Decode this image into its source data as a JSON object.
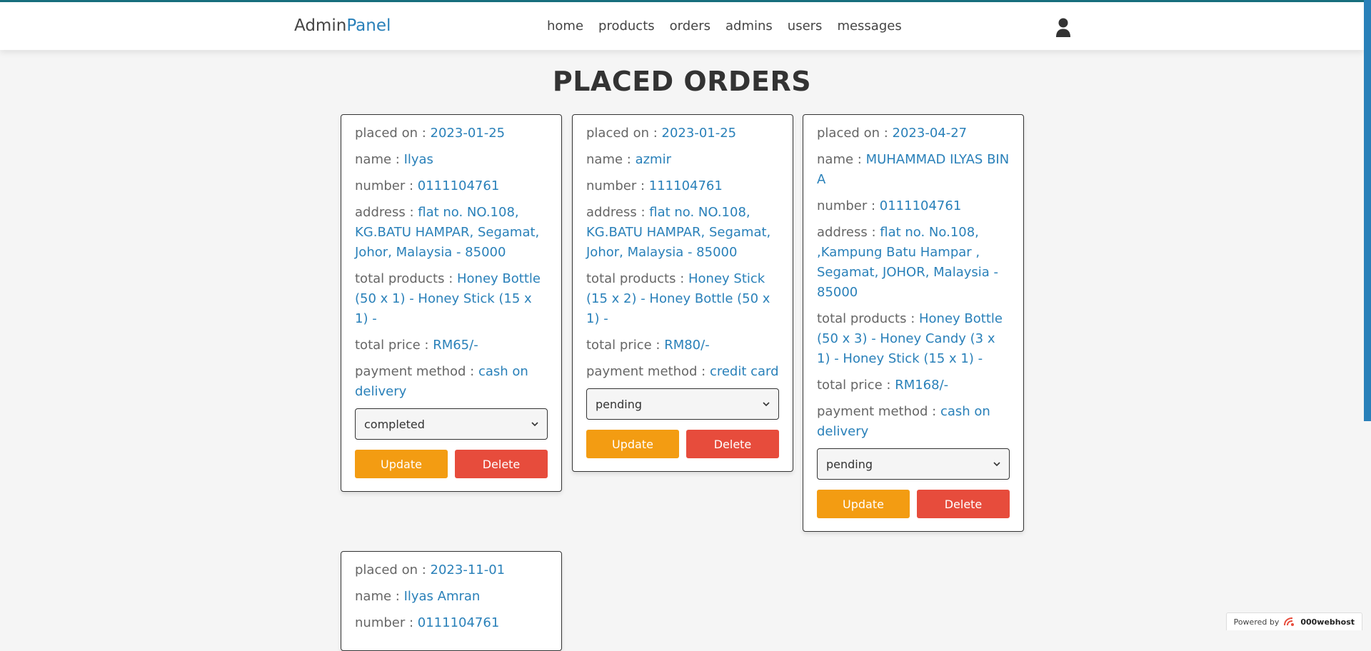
{
  "header": {
    "logo_main": "Admin",
    "logo_accent": "Panel",
    "nav": [
      "home",
      "products",
      "orders",
      "admins",
      "users",
      "messages"
    ]
  },
  "page_title": "PLACED ORDERS",
  "labels": {
    "placed_on": "placed on : ",
    "name": "name : ",
    "number": "number : ",
    "address": "address : ",
    "total_products": "total products : ",
    "total_price": "total price : ",
    "payment_method": "payment method : ",
    "update": "Update",
    "delete": "Delete"
  },
  "orders": [
    {
      "placed_on": "2023-01-25",
      "name": "Ilyas",
      "number": "0111104761",
      "address": "flat no. NO.108, KG.BATU HAMPAR, Segamat, Johor, Malaysia - 85000",
      "total_products": "Honey Bottle (50 x 1) - Honey Stick (15 x 1) -",
      "total_price": "RM65/-",
      "payment_method": "cash on delivery",
      "status": "completed"
    },
    {
      "placed_on": "2023-01-25",
      "name": "azmir",
      "number": "111104761",
      "address": "flat no. NO.108, KG.BATU HAMPAR, Segamat, Johor, Malaysia - 85000",
      "total_products": "Honey Stick (15 x 2) - Honey Bottle (50 x 1) -",
      "total_price": "RM80/-",
      "payment_method": "credit card",
      "status": "pending"
    },
    {
      "placed_on": "2023-04-27",
      "name": "MUHAMMAD ILYAS BIN A",
      "number": "0111104761",
      "address": "flat no. No.108, ,Kampung Batu Hampar , Segamat, JOHOR, Malaysia - 85000",
      "total_products": "Honey Bottle (50 x 3) - Honey Candy (3 x 1) - Honey Stick (15 x 1) -",
      "total_price": "RM168/-",
      "payment_method": "cash on delivery",
      "status": "pending"
    },
    {
      "placed_on": "2023-11-01",
      "name": "Ilyas Amran",
      "number": "0111104761"
    }
  ],
  "footer_badge": {
    "prefix": "Powered by",
    "brand": "000webhost"
  },
  "colors": {
    "accent": "#2980b9",
    "update_button": "#f39c12",
    "delete_button": "#e74c3c",
    "header_border": "#176e7d"
  },
  "icons": [
    "user-icon",
    "chevron-down-icon",
    "webhost-logo-icon"
  ]
}
